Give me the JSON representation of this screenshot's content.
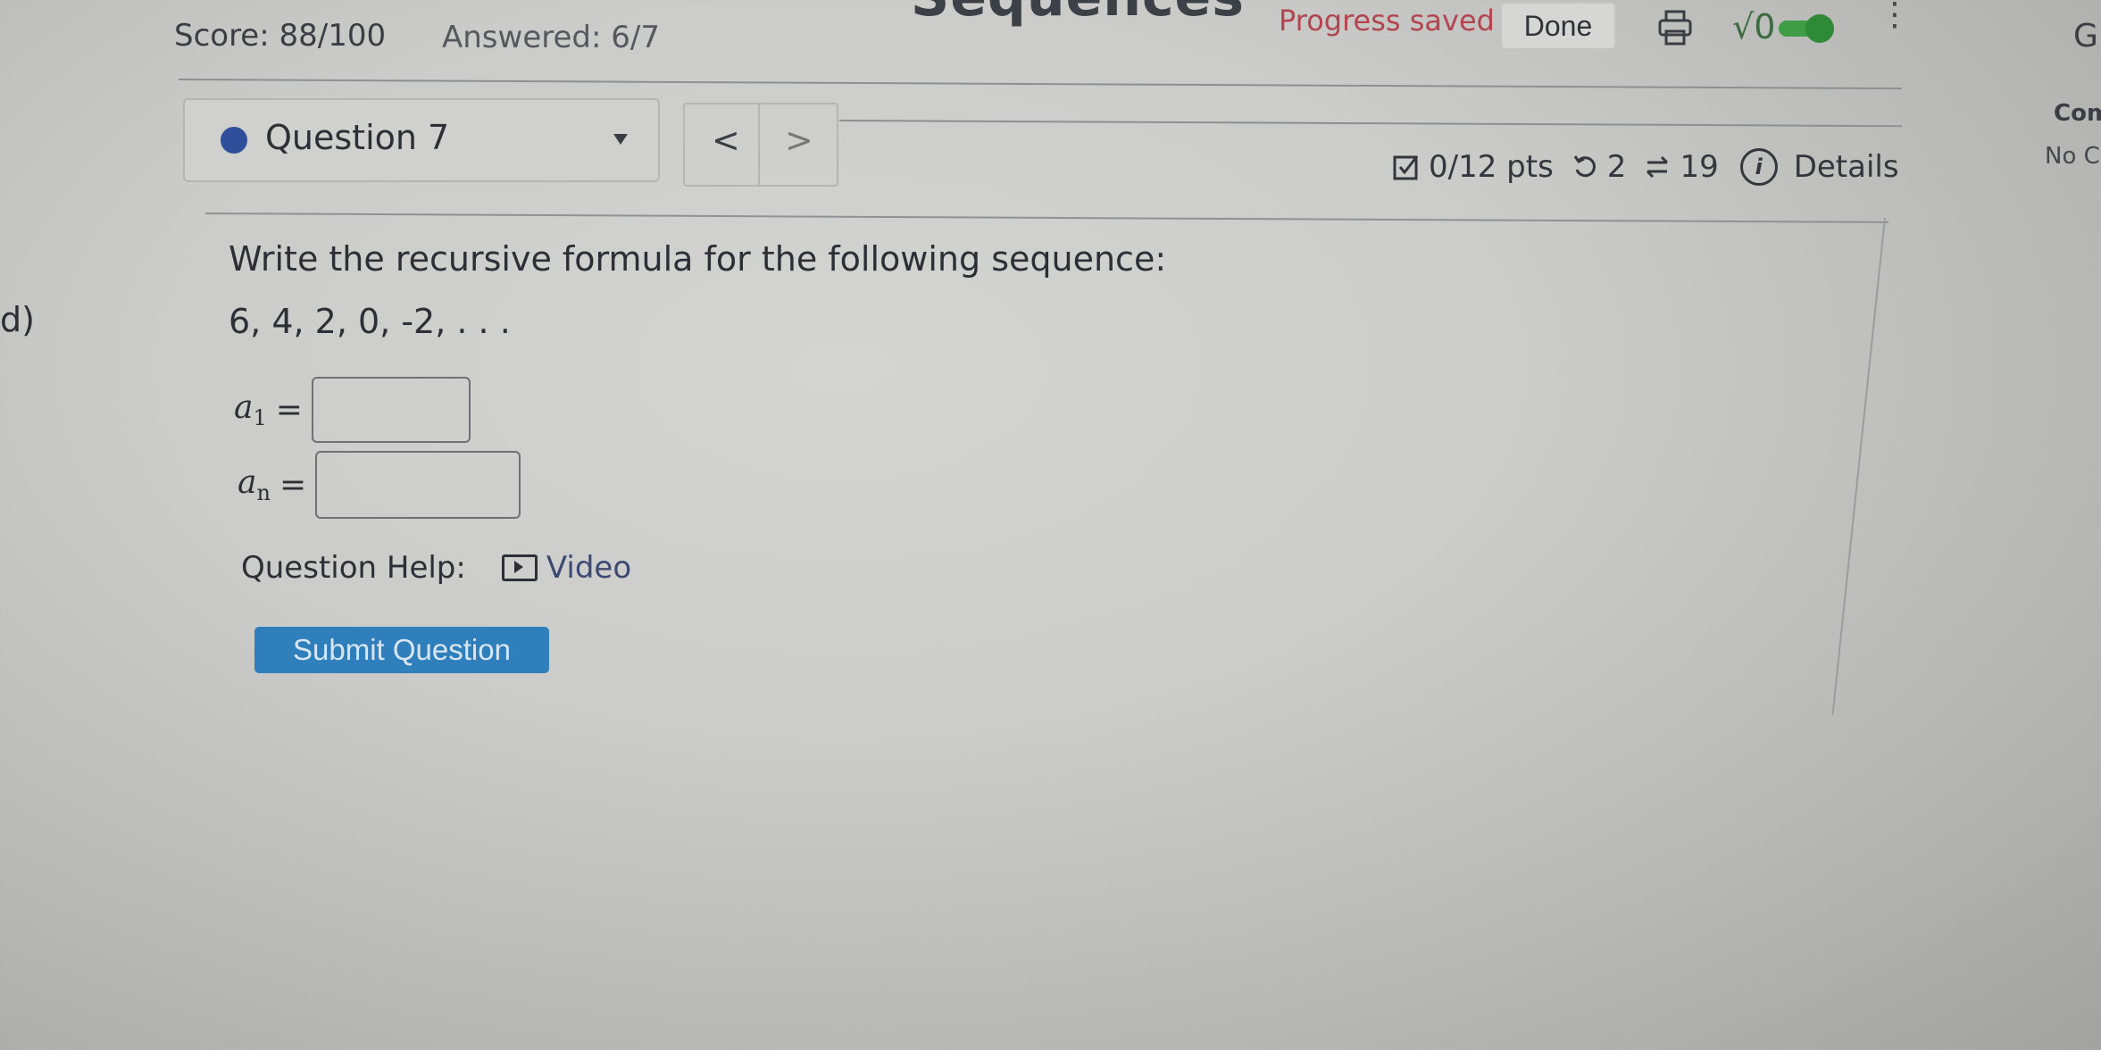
{
  "header": {
    "page_title_fragment": "Sequences",
    "score": "Score: 88/100",
    "answered": "Answered: 6/7",
    "progress_status": "Progress saved",
    "done_label": "Done",
    "sqrt_label": "√0",
    "right_cut_text": "Gr"
  },
  "sidebar_right": {
    "heading_fragment": "Com",
    "text_fragment": "No C"
  },
  "question_nav": {
    "selected_question": "Question 7",
    "prev_symbol": "<",
    "next_symbol": ">"
  },
  "meta": {
    "points": "0/12 pts",
    "retries": "2",
    "attempts": "19",
    "info_symbol": "i",
    "details_label": "Details"
  },
  "question": {
    "prompt": "Write the recursive formula for the following sequence:",
    "part_label": "d)",
    "sequence": "6, 4, 2, 0, -2, . . .",
    "answers": [
      {
        "label": "a",
        "subscript": "1",
        "value": ""
      },
      {
        "label": "a",
        "subscript": "n",
        "value": ""
      }
    ],
    "help_label": "Question Help:",
    "video_label": "Video",
    "submit_label": "Submit Question"
  },
  "colors": {
    "accent_blue": "#2f7fbd",
    "progress_red": "#b2454f",
    "toggle_green": "#3e9d45",
    "question_dot": "#2f4f9a"
  }
}
